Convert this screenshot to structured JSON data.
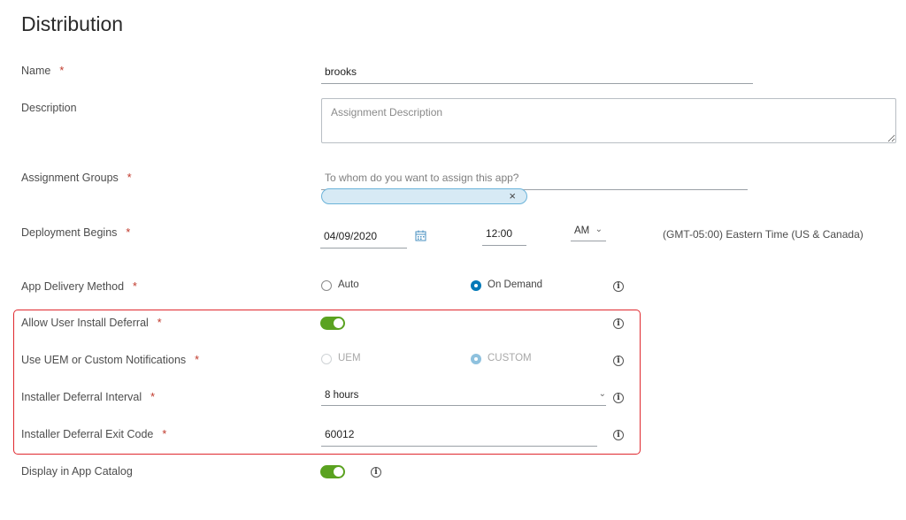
{
  "page_title": "Distribution",
  "required_marker": "*",
  "fields": {
    "name": {
      "label": "Name",
      "value": "brooks"
    },
    "description": {
      "label": "Description",
      "placeholder": "Assignment Description"
    },
    "assignment_groups": {
      "label": "Assignment Groups",
      "placeholder": "To whom do you want to assign this app?",
      "chip_remove": "×"
    },
    "deployment_begins": {
      "label": "Deployment Begins",
      "date": "04/09/2020",
      "time": "12:00",
      "ampm": "AM",
      "timezone": "(GMT-05:00) Eastern Time (US & Canada)"
    },
    "app_delivery_method": {
      "label": "App Delivery Method",
      "option_auto": "Auto",
      "option_on_demand": "On Demand",
      "selected": "On Demand"
    },
    "allow_user_install_deferral": {
      "label": "Allow User Install Deferral",
      "enabled": true
    },
    "notifications": {
      "label": "Use UEM or Custom Notifications",
      "option_uem": "UEM",
      "option_custom": "CUSTOM",
      "selected": "CUSTOM"
    },
    "installer_deferral_interval": {
      "label": "Installer Deferral Interval",
      "value": "8 hours"
    },
    "installer_deferral_exit_code": {
      "label": "Installer Deferral Exit Code",
      "value": "60012"
    },
    "display_in_app_catalog": {
      "label": "Display in App Catalog",
      "enabled": true
    }
  },
  "colors": {
    "accent": "#0079b8",
    "toggle_on": "#5aa220",
    "highlight": "#e0282e",
    "chip_bg": "#d7eaf5"
  }
}
